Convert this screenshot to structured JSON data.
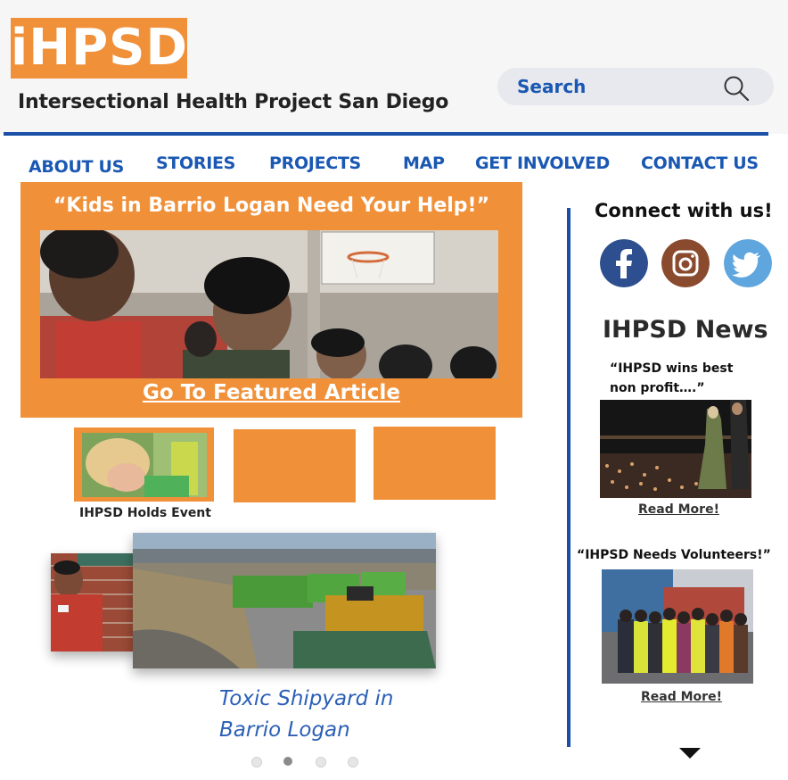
{
  "header": {
    "logo_text": "iHPSD",
    "tagline": "Intersectional Health Project San Diego",
    "search_placeholder": "Search"
  },
  "nav": {
    "items": [
      "ABOUT US",
      "STORIES",
      "PROJECTS",
      "MAP",
      "GET INVOLVED",
      "CONTACT US"
    ]
  },
  "featured": {
    "title": "“Kids in Barrio Logan Need Your Help!”",
    "link_label": "Go To Featured Article"
  },
  "thumbnails": {
    "caption": "IHPSD Holds Event"
  },
  "carousel": {
    "caption": "Toxic Shipyard in Barrio Logan",
    "active_index": 1,
    "dot_count": 4
  },
  "sidebar": {
    "connect_title": "Connect with us!",
    "social": [
      "facebook-icon",
      "instagram-icon",
      "twitter-icon"
    ],
    "news_title": "IHPSD News",
    "news": [
      {
        "headline": "“IHPSD wins best non profit….”",
        "read_more": "Read More!"
      },
      {
        "headline": "“IHPSD Needs Volunteers!”",
        "read_more": "Read More!"
      }
    ]
  },
  "colors": {
    "brand_orange": "#f0913a",
    "brand_blue": "#1a4fa8",
    "link_blue": "#1a58b3"
  }
}
